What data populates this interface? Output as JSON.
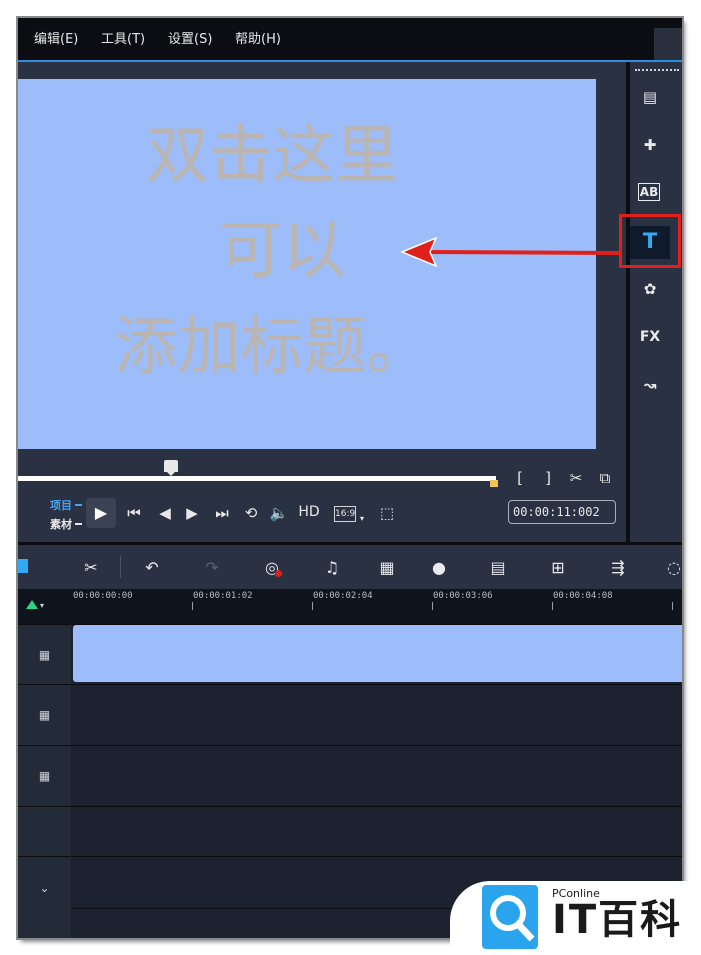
{
  "menu": {
    "items": [
      "编辑(E)",
      "工具(T)",
      "设置(S)",
      "帮助(H)"
    ]
  },
  "preview": {
    "title_lines": [
      "双击这里",
      "可以",
      "添加标题。"
    ],
    "mode_project": "项目",
    "mode_clip": "素材",
    "hd_label": "HD",
    "aspect_label": "16:9",
    "timecode": "00:00:11:002",
    "scrub_progress": 0.31
  },
  "tool_panel": {
    "tools": [
      {
        "name": "media",
        "label": "▤"
      },
      {
        "name": "instant-project",
        "label": "✚"
      },
      {
        "name": "transition",
        "label": "AB"
      },
      {
        "name": "title",
        "label": "T"
      },
      {
        "name": "graphic",
        "label": "✿"
      },
      {
        "name": "filter",
        "label": "FX"
      },
      {
        "name": "path",
        "label": "↝"
      }
    ],
    "highlighted_tool": "title",
    "highlight_color": "#e0201a"
  },
  "timeline": {
    "ruler_labels": [
      "00:00:00:00",
      "00:00:01:02",
      "00:00:02:04",
      "00:00:03:06",
      "00:00:04:08"
    ],
    "clip_color": "#9dbdfa"
  },
  "watermark": {
    "small": "PConline",
    "main": "IT百科",
    "brand_color": "#2aa4ec"
  },
  "annotation": {
    "arrow_color": "#e0201a"
  }
}
